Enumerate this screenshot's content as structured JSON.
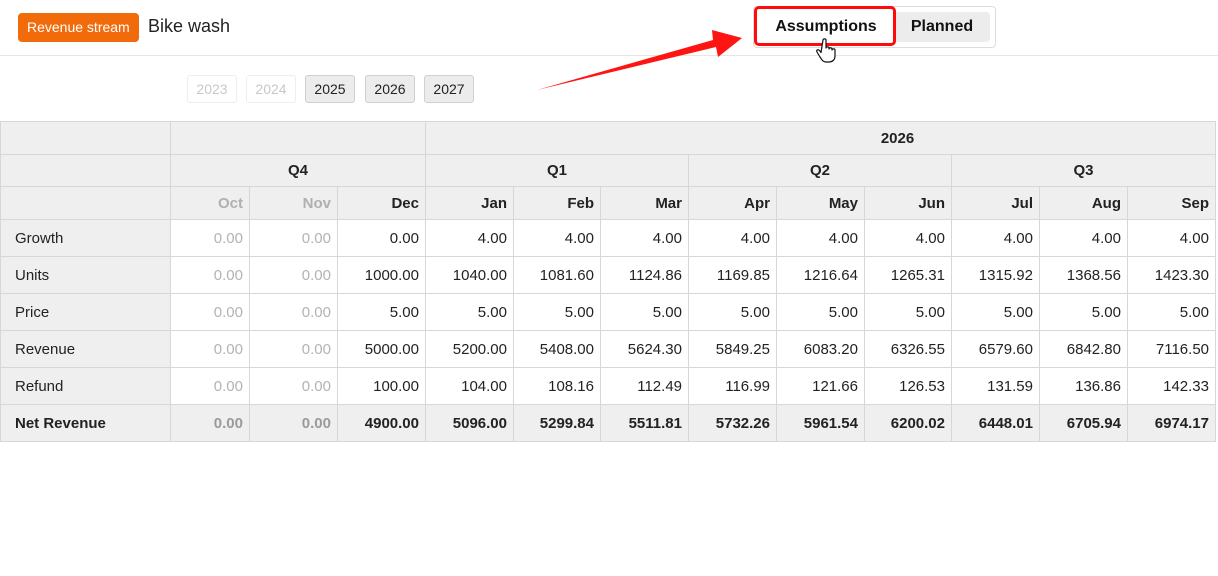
{
  "header": {
    "badge": "Revenue stream",
    "title": "Bike wash",
    "tabs": [
      {
        "label": "Assumptions",
        "active": true
      },
      {
        "label": "Planned",
        "active": false
      }
    ]
  },
  "years": [
    {
      "label": "2023",
      "enabled": false
    },
    {
      "label": "2024",
      "enabled": false
    },
    {
      "label": "2025",
      "enabled": true
    },
    {
      "label": "2026",
      "enabled": true
    },
    {
      "label": "2027",
      "enabled": true
    }
  ],
  "table": {
    "year_label": "2026",
    "quarters": [
      "Q4",
      "Q1",
      "Q2",
      "Q3"
    ],
    "months": [
      "Oct",
      "Nov",
      "Dec",
      "Jan",
      "Feb",
      "Mar",
      "Apr",
      "May",
      "Jun",
      "Jul",
      "Aug",
      "Sep"
    ],
    "rows": [
      {
        "label": "Growth",
        "values": [
          "0.00",
          "0.00",
          "0.00",
          "4.00",
          "4.00",
          "4.00",
          "4.00",
          "4.00",
          "4.00",
          "4.00",
          "4.00",
          "4.00"
        ]
      },
      {
        "label": "Units",
        "values": [
          "0.00",
          "0.00",
          "1000.00",
          "1040.00",
          "1081.60",
          "1124.86",
          "1169.85",
          "1216.64",
          "1265.31",
          "1315.92",
          "1368.56",
          "1423.30"
        ]
      },
      {
        "label": "Price",
        "values": [
          "0.00",
          "0.00",
          "5.00",
          "5.00",
          "5.00",
          "5.00",
          "5.00",
          "5.00",
          "5.00",
          "5.00",
          "5.00",
          "5.00"
        ]
      },
      {
        "label": "Revenue",
        "values": [
          "0.00",
          "0.00",
          "5000.00",
          "5200.00",
          "5408.00",
          "5624.30",
          "5849.25",
          "6083.20",
          "6326.55",
          "6579.60",
          "6842.80",
          "7116.50"
        ]
      },
      {
        "label": "Refund",
        "values": [
          "0.00",
          "0.00",
          "100.00",
          "104.00",
          "108.16",
          "112.49",
          "116.99",
          "121.66",
          "126.53",
          "131.59",
          "136.86",
          "142.33"
        ]
      },
      {
        "label": "Net Revenue",
        "values": [
          "0.00",
          "0.00",
          "4900.00",
          "5096.00",
          "5299.84",
          "5511.81",
          "5732.26",
          "5961.54",
          "6200.02",
          "6448.01",
          "6705.94",
          "6974.17"
        ]
      }
    ]
  },
  "colors": {
    "badge": "#f26b0b",
    "highlight": "#ff0b0b"
  },
  "icons": [
    "pointer-hand-icon",
    "annotation-arrow-icon"
  ]
}
